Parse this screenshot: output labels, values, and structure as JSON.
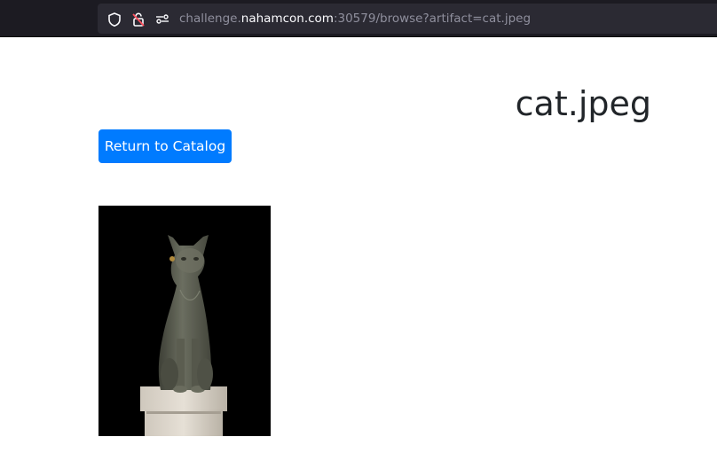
{
  "browser": {
    "url_prefix": "challenge.",
    "url_host": "nahamcon.com",
    "url_suffix": ":30579/browse?artifact=cat.jpeg",
    "icons": [
      "shield-icon",
      "lock-warning-icon",
      "permissions-icon"
    ]
  },
  "page": {
    "title": "cat.jpeg",
    "return_button_label": "Return to Catalog"
  },
  "colors": {
    "button": "#007bff",
    "browser_bar": "#1c1b22",
    "url_field": "#2b2a33"
  }
}
